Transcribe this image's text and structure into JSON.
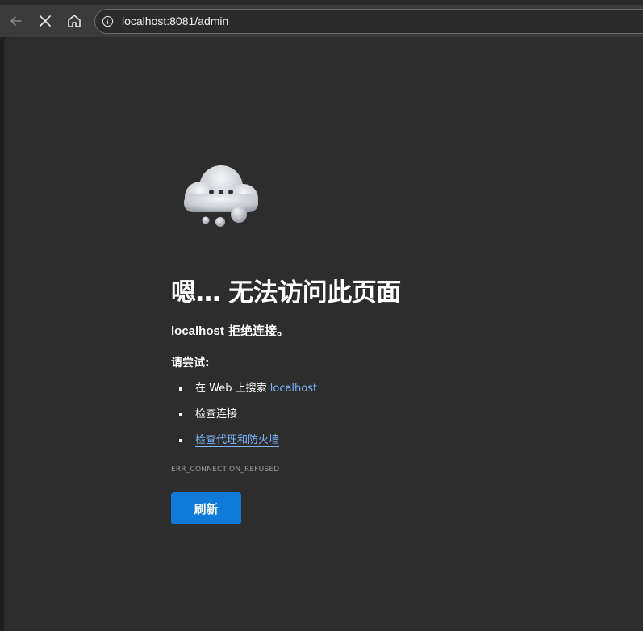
{
  "browser": {
    "url": "localhost:8081/admin",
    "icons": [
      "back-arrow-icon",
      "close-icon",
      "home-icon",
      "info-icon"
    ]
  },
  "error_page": {
    "title": "嗯… 无法访问此页面",
    "subtitle_host": "localhost",
    "subtitle_rest": " 拒绝连接。",
    "try_label": "请尝试:",
    "suggestions": [
      {
        "prefix": "在 Web 上搜索 ",
        "link": "localhost"
      },
      {
        "text": "检查连接"
      },
      {
        "link": "检查代理和防火墙"
      }
    ],
    "error_code": "ERR_CONNECTION_REFUSED",
    "refresh_label": "刷新"
  },
  "colors": {
    "background": "#2d2d2d",
    "toolbar": "#3b3b3b",
    "link": "#7db6ff",
    "button": "#0f7ad8"
  }
}
